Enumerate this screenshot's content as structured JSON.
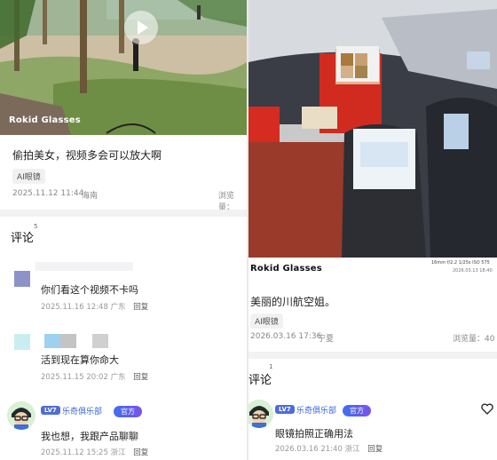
{
  "left": {
    "brand": "Rokid Glasses",
    "caption": "偷拍美女，视频多会可以放大啊",
    "tag": "AI眼镜",
    "date": "2025.11.12 11:44",
    "location": "海南",
    "views_label": "浏览量：",
    "comments_title": "评论",
    "comments_count": "5",
    "comments": [
      {
        "text": "你们看这个视频不卡吗",
        "date": "2025.11.16 12:48",
        "location": "广东",
        "reply": "回复"
      },
      {
        "text": "活到现在算你命大",
        "date": "2025.11.15 20:02",
        "location": "广东",
        "reply": "回复"
      },
      {
        "text": "我也想，我跟产品聊聊",
        "date": "2025.11.12 15:25",
        "location": "浙江",
        "reply": "回复",
        "level": "LV7",
        "club": "乐奇俱乐部",
        "badge": "官方"
      }
    ]
  },
  "right": {
    "brand": "Rokid Glasses",
    "exif": "16mm f/2.2 1/25s ISO 575",
    "photo_date": "2026.03.13 18:40",
    "caption": "美丽的川航空姐。",
    "tag": "AI眼镜",
    "date": "2026.03.16 17:36",
    "location": "宁夏",
    "views_label": "浏览量：",
    "views": "40",
    "comments_title": "评论",
    "comments_count": "1",
    "comments": [
      {
        "text": "眼镜拍照正确用法",
        "date": "2026.03.16 21:40",
        "location": "浙江",
        "reply": "回复",
        "level": "LV7",
        "club": "乐奇俱乐部",
        "badge": "官方"
      }
    ]
  },
  "colors": {
    "accent": "#3a64d8",
    "highlight": "#ffd84a",
    "badge": "#5b5fe6"
  }
}
